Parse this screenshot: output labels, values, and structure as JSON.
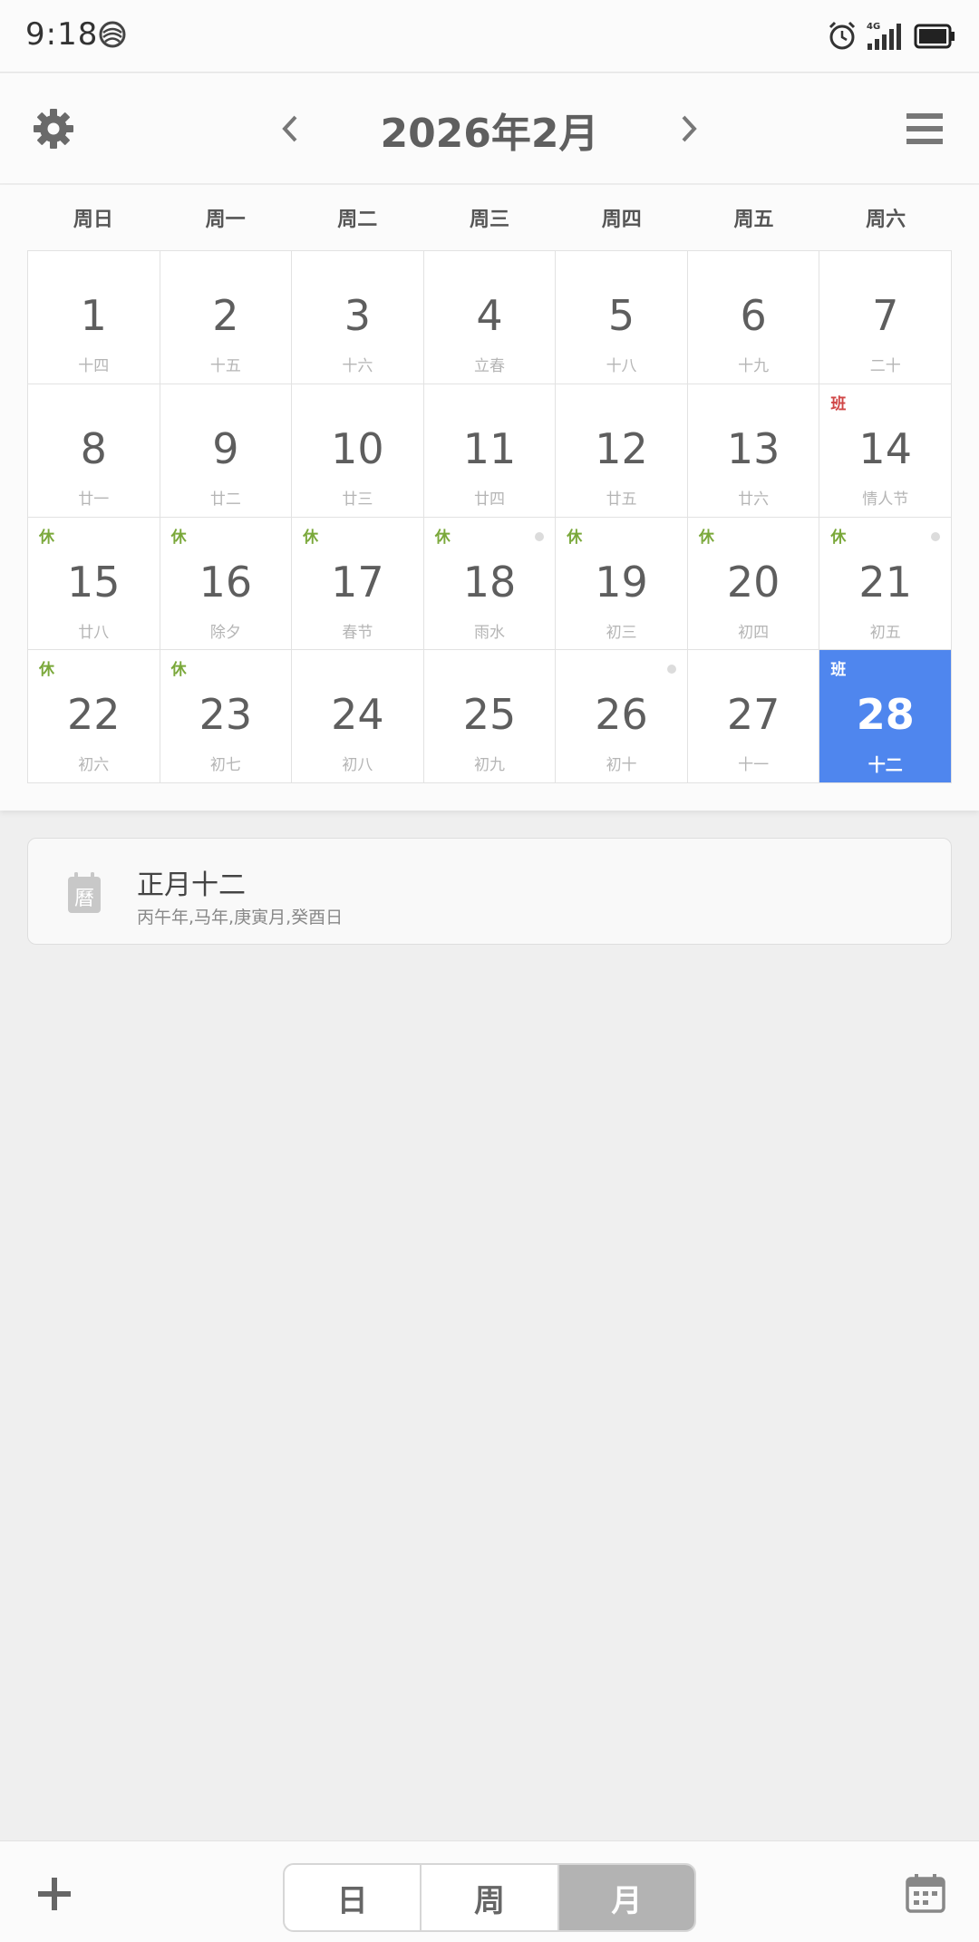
{
  "status_bar": {
    "time": "9:18",
    "network": "4G",
    "icons": [
      "carrier-icon",
      "alarm-icon",
      "signal-icon",
      "battery-icon"
    ]
  },
  "header": {
    "title": "2026年2月",
    "icons": [
      "gear-icon",
      "chevron-left-icon",
      "chevron-right-icon",
      "menu-icon"
    ]
  },
  "weekdays": [
    "周日",
    "周一",
    "周二",
    "周三",
    "周四",
    "周五",
    "周六"
  ],
  "days": [
    {
      "day": "1",
      "lunar": "十四",
      "tag": "",
      "tag_type": "",
      "dot": false,
      "selected": false
    },
    {
      "day": "2",
      "lunar": "十五",
      "tag": "",
      "tag_type": "",
      "dot": false,
      "selected": false
    },
    {
      "day": "3",
      "lunar": "十六",
      "tag": "",
      "tag_type": "",
      "dot": false,
      "selected": false
    },
    {
      "day": "4",
      "lunar": "立春",
      "tag": "",
      "tag_type": "",
      "dot": false,
      "selected": false
    },
    {
      "day": "5",
      "lunar": "十八",
      "tag": "",
      "tag_type": "",
      "dot": false,
      "selected": false
    },
    {
      "day": "6",
      "lunar": "十九",
      "tag": "",
      "tag_type": "",
      "dot": false,
      "selected": false
    },
    {
      "day": "7",
      "lunar": "二十",
      "tag": "",
      "tag_type": "",
      "dot": false,
      "selected": false
    },
    {
      "day": "8",
      "lunar": "廿一",
      "tag": "",
      "tag_type": "",
      "dot": false,
      "selected": false
    },
    {
      "day": "9",
      "lunar": "廿二",
      "tag": "",
      "tag_type": "",
      "dot": false,
      "selected": false
    },
    {
      "day": "10",
      "lunar": "廿三",
      "tag": "",
      "tag_type": "",
      "dot": false,
      "selected": false
    },
    {
      "day": "11",
      "lunar": "廿四",
      "tag": "",
      "tag_type": "",
      "dot": false,
      "selected": false
    },
    {
      "day": "12",
      "lunar": "廿五",
      "tag": "",
      "tag_type": "",
      "dot": false,
      "selected": false
    },
    {
      "day": "13",
      "lunar": "廿六",
      "tag": "",
      "tag_type": "",
      "dot": false,
      "selected": false
    },
    {
      "day": "14",
      "lunar": "情人节",
      "tag": "班",
      "tag_type": "work",
      "dot": false,
      "selected": false
    },
    {
      "day": "15",
      "lunar": "廿八",
      "tag": "休",
      "tag_type": "rest",
      "dot": false,
      "selected": false
    },
    {
      "day": "16",
      "lunar": "除夕",
      "tag": "休",
      "tag_type": "rest",
      "dot": false,
      "selected": false
    },
    {
      "day": "17",
      "lunar": "春节",
      "tag": "休",
      "tag_type": "rest",
      "dot": false,
      "selected": false
    },
    {
      "day": "18",
      "lunar": "雨水",
      "tag": "休",
      "tag_type": "rest",
      "dot": true,
      "selected": false
    },
    {
      "day": "19",
      "lunar": "初三",
      "tag": "休",
      "tag_type": "rest",
      "dot": false,
      "selected": false
    },
    {
      "day": "20",
      "lunar": "初四",
      "tag": "休",
      "tag_type": "rest",
      "dot": false,
      "selected": false
    },
    {
      "day": "21",
      "lunar": "初五",
      "tag": "休",
      "tag_type": "rest",
      "dot": true,
      "selected": false
    },
    {
      "day": "22",
      "lunar": "初六",
      "tag": "休",
      "tag_type": "rest",
      "dot": false,
      "selected": false
    },
    {
      "day": "23",
      "lunar": "初七",
      "tag": "休",
      "tag_type": "rest",
      "dot": false,
      "selected": false
    },
    {
      "day": "24",
      "lunar": "初八",
      "tag": "",
      "tag_type": "",
      "dot": false,
      "selected": false
    },
    {
      "day": "25",
      "lunar": "初九",
      "tag": "",
      "tag_type": "",
      "dot": false,
      "selected": false
    },
    {
      "day": "26",
      "lunar": "初十",
      "tag": "",
      "tag_type": "",
      "dot": true,
      "selected": false
    },
    {
      "day": "27",
      "lunar": "十一",
      "tag": "",
      "tag_type": "",
      "dot": false,
      "selected": false
    },
    {
      "day": "28",
      "lunar": "十二",
      "tag": "班",
      "tag_type": "work",
      "dot": false,
      "selected": true
    }
  ],
  "info_card": {
    "icon": "almanac-icon",
    "icon_char": "曆",
    "title": "正月十二",
    "subtitle": "丙午年,马年,庚寅月,癸酉日"
  },
  "bottom_bar": {
    "view_options": [
      "日",
      "周",
      "月"
    ],
    "active_view": "月",
    "icons": [
      "plus-icon",
      "calendar-icon"
    ]
  },
  "colors": {
    "accent": "#4f86ee",
    "rest_tag": "#7aa83a",
    "work_tag": "#d04646",
    "active_view_bg": "#b3b3b3"
  }
}
